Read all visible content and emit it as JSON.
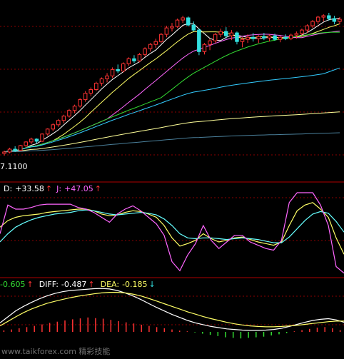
{
  "chart_data": [
    {
      "type": "candlestick",
      "panel": "price",
      "low_price_label": "7.1100",
      "colors": {
        "up": "#ff3333",
        "down": "#33e0e0"
      },
      "candles": [
        [
          7.18,
          7.22,
          7.15,
          7.2
        ],
        [
          7.2,
          7.26,
          7.18,
          7.24
        ],
        [
          7.24,
          7.28,
          7.2,
          7.22
        ],
        [
          7.22,
          7.3,
          7.21,
          7.29
        ],
        [
          7.29,
          7.35,
          7.27,
          7.34
        ],
        [
          7.34,
          7.4,
          7.31,
          7.38
        ],
        [
          7.38,
          7.39,
          7.32,
          7.35
        ],
        [
          7.35,
          7.46,
          7.34,
          7.45
        ],
        [
          7.45,
          7.53,
          7.43,
          7.52
        ],
        [
          7.52,
          7.6,
          7.49,
          7.58
        ],
        [
          7.58,
          7.66,
          7.55,
          7.64
        ],
        [
          7.64,
          7.72,
          7.6,
          7.7
        ],
        [
          7.7,
          7.8,
          7.68,
          7.78
        ],
        [
          7.78,
          7.86,
          7.74,
          7.84
        ],
        [
          7.84,
          7.95,
          7.82,
          7.93
        ],
        [
          7.93,
          8.05,
          7.9,
          8.02
        ],
        [
          8.02,
          8.1,
          7.98,
          8.07
        ],
        [
          8.07,
          8.18,
          8.05,
          8.16
        ],
        [
          8.16,
          8.24,
          8.12,
          8.22
        ],
        [
          8.22,
          8.3,
          8.17,
          8.26
        ],
        [
          8.26,
          8.38,
          8.23,
          8.35
        ],
        [
          8.35,
          8.42,
          8.3,
          8.33
        ],
        [
          8.33,
          8.45,
          8.31,
          8.43
        ],
        [
          8.43,
          8.52,
          8.4,
          8.5
        ],
        [
          8.5,
          8.55,
          8.44,
          8.47
        ],
        [
          8.47,
          8.58,
          8.45,
          8.56
        ],
        [
          8.56,
          8.66,
          8.53,
          8.64
        ],
        [
          8.64,
          8.72,
          8.6,
          8.7
        ],
        [
          8.7,
          8.78,
          8.65,
          8.74
        ],
        [
          8.74,
          8.86,
          8.72,
          8.84
        ],
        [
          8.84,
          8.96,
          8.8,
          8.93
        ],
        [
          8.93,
          9.0,
          8.88,
          8.95
        ],
        [
          8.95,
          9.06,
          8.93,
          9.04
        ],
        [
          9.04,
          9.1,
          9.0,
          9.07
        ],
        [
          9.07,
          9.09,
          8.95,
          8.97
        ],
        [
          8.97,
          9.02,
          8.88,
          8.9
        ],
        [
          8.9,
          8.92,
          8.55,
          8.6
        ],
        [
          8.6,
          8.72,
          8.56,
          8.7
        ],
        [
          8.7,
          8.78,
          8.62,
          8.75
        ],
        [
          8.75,
          8.86,
          8.72,
          8.84
        ],
        [
          8.84,
          8.92,
          8.8,
          8.88
        ],
        [
          8.88,
          8.94,
          8.78,
          8.82
        ],
        [
          8.82,
          8.9,
          8.76,
          8.86
        ],
        [
          8.86,
          8.88,
          8.7,
          8.74
        ],
        [
          8.74,
          8.8,
          8.66,
          8.77
        ],
        [
          8.77,
          8.84,
          8.72,
          8.8
        ],
        [
          8.8,
          8.86,
          8.74,
          8.78
        ],
        [
          8.78,
          8.83,
          8.72,
          8.81
        ],
        [
          8.81,
          8.86,
          8.76,
          8.79
        ],
        [
          8.79,
          8.84,
          8.74,
          8.82
        ],
        [
          8.82,
          8.85,
          8.75,
          8.77
        ],
        [
          8.77,
          8.82,
          8.73,
          8.8
        ],
        [
          8.8,
          8.84,
          8.76,
          8.78
        ],
        [
          8.78,
          8.85,
          8.76,
          8.83
        ],
        [
          8.83,
          8.88,
          8.78,
          8.85
        ],
        [
          8.85,
          8.92,
          8.82,
          8.9
        ],
        [
          8.9,
          8.98,
          8.86,
          8.96
        ],
        [
          8.96,
          9.04,
          8.93,
          9.02
        ],
        [
          9.02,
          9.1,
          8.98,
          9.08
        ],
        [
          9.08,
          9.12,
          9.02,
          9.1
        ],
        [
          9.1,
          9.14,
          9.03,
          9.06
        ],
        [
          9.06,
          9.1,
          8.98,
          9.02
        ],
        [
          9.02,
          9.08,
          8.98,
          9.05
        ]
      ],
      "moving_averages": [
        {
          "color": "#ffffff"
        },
        {
          "color": "#ffff66"
        },
        {
          "color": "#ff66ff"
        },
        {
          "color": "#33dd33"
        },
        {
          "color": "#33ccff"
        },
        {
          "color": "#ffff99"
        },
        {
          "color": "#4a7f9a"
        }
      ]
    },
    {
      "type": "line",
      "panel": "kdj",
      "readouts": [
        {
          "label": "D:",
          "value": "+33.58",
          "arrow": "↑",
          "label_color": "#ffffff",
          "value_color": "#ffffff"
        },
        {
          "label": "J:",
          "value": "+47.05",
          "arrow": "↑",
          "label_color": "#ff66ff",
          "value_color": "#ff66ff"
        }
      ],
      "series": [
        {
          "key": "K",
          "color": "#ffff66",
          "values": [
            58,
            66,
            70,
            72,
            73,
            74,
            76,
            77,
            78,
            79,
            80,
            80,
            78,
            74,
            72,
            73,
            76,
            78,
            77,
            74,
            70,
            60,
            45,
            35,
            38,
            42,
            50,
            44,
            40,
            42,
            45,
            46,
            43,
            40,
            38,
            36,
            40,
            60,
            78,
            85,
            88,
            80,
            70,
            45,
            25
          ]
        },
        {
          "key": "D",
          "color": "#66ffff",
          "values": [
            40,
            50,
            58,
            63,
            67,
            70,
            72,
            74,
            75,
            76,
            78,
            79,
            78,
            76,
            74,
            73,
            74,
            75,
            76,
            75,
            73,
            68,
            60,
            50,
            45,
            44,
            45,
            45,
            44,
            43,
            44,
            45,
            44,
            43,
            41,
            39,
            39,
            46,
            56,
            66,
            74,
            77,
            75,
            65,
            52
          ]
        },
        {
          "key": "J",
          "color": "#ff66ff",
          "values": [
            50,
            85,
            80,
            80,
            82,
            85,
            86,
            86,
            86,
            86,
            82,
            80,
            76,
            70,
            64,
            74,
            80,
            84,
            78,
            70,
            62,
            48,
            16,
            5,
            24,
            38,
            60,
            42,
            32,
            40,
            48,
            48,
            40,
            36,
            32,
            30,
            42,
            88,
            100,
            100,
            100,
            85,
            60,
            10,
            2
          ]
        }
      ]
    },
    {
      "type": "bar_line",
      "panel": "macd",
      "readouts": [
        {
          "label": "",
          "value": "-0.605",
          "arrow": "↑",
          "label_color": "#33dd33",
          "value_color": "#33dd33"
        },
        {
          "label": "DIFF:",
          "value": "-0.487",
          "arrow": "↑",
          "label_color": "#ffffff",
          "value_color": "#ffffff"
        },
        {
          "label": "DEA:",
          "value": "-0.185",
          "arrow": "↓",
          "label_color": "#ffff66",
          "value_color": "#ffff66"
        }
      ],
      "bars": [
        0.05,
        0.08,
        0.12,
        0.16,
        0.2,
        0.25,
        0.3,
        0.34,
        0.38,
        0.42,
        0.45,
        0.48,
        0.46,
        0.44,
        0.4,
        0.36,
        0.32,
        0.28,
        0.24,
        0.2,
        0.16,
        0.12,
        0.08,
        0.04,
        0.02,
        -0.02,
        -0.06,
        -0.1,
        -0.14,
        -0.18,
        -0.2,
        -0.22,
        -0.2,
        -0.18,
        -0.16,
        -0.12,
        -0.08,
        -0.04,
        0.02,
        0.06,
        0.1,
        0.14,
        0.16,
        0.12,
        0.06
      ],
      "series": [
        {
          "key": "DIFF",
          "color": "#ffffff",
          "values": [
            0.3,
            0.5,
            0.7,
            0.85,
            0.98,
            1.1,
            1.2,
            1.28,
            1.34,
            1.38,
            1.4,
            1.42,
            1.44,
            1.45,
            1.43,
            1.38,
            1.3,
            1.2,
            1.08,
            0.95,
            0.82,
            0.7,
            0.58,
            0.48,
            0.38,
            0.3,
            0.24,
            0.18,
            0.14,
            0.1,
            0.08,
            0.06,
            0.05,
            0.05,
            0.06,
            0.08,
            0.12,
            0.18,
            0.25,
            0.32,
            0.38,
            0.42,
            0.44,
            0.4,
            0.32
          ]
        },
        {
          "key": "DEA",
          "color": "#ffff66",
          "values": [
            0.2,
            0.35,
            0.5,
            0.64,
            0.76,
            0.86,
            0.95,
            1.02,
            1.08,
            1.14,
            1.19,
            1.23,
            1.27,
            1.3,
            1.32,
            1.32,
            1.3,
            1.26,
            1.2,
            1.12,
            1.03,
            0.94,
            0.85,
            0.76,
            0.67,
            0.59,
            0.51,
            0.44,
            0.38,
            0.32,
            0.27,
            0.23,
            0.2,
            0.18,
            0.17,
            0.17,
            0.18,
            0.2,
            0.22,
            0.25,
            0.28,
            0.31,
            0.34,
            0.36,
            0.36
          ]
        }
      ]
    }
  ],
  "watermark": "www.taikforex.com 精彩技能"
}
